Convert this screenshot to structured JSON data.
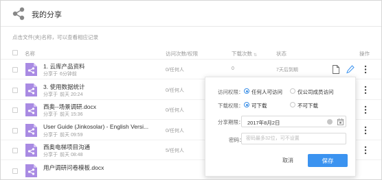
{
  "header": {
    "title": "我的分享"
  },
  "hint": "点击文件(夹)名称，可以查看相应记录",
  "columns": {
    "name": "名称",
    "access": "访问次数/权限",
    "downloads": "下载次数",
    "status": "状态",
    "actions": "操作"
  },
  "rows": [
    {
      "name": "1. 云库产品资料",
      "sub_prefix": "分享于",
      "sub_time": "6分钟前",
      "access": "0/任何人",
      "count": "0",
      "status": "7天后到期"
    },
    {
      "name": "3. 使用数据统计",
      "sub_prefix": "分享于",
      "sub_time": "前天 20:24",
      "access": "0/任何人",
      "count": "",
      "status": ""
    },
    {
      "name": "西奥--场景调研.docx",
      "sub_prefix": "分享于",
      "sub_time": "前天 15:36",
      "access": "0/任何人",
      "count": "",
      "status": ""
    },
    {
      "name": "User Guide (Jinkosolar) - English Versi...",
      "sub_prefix": "分享于",
      "sub_time": "前天 09:59",
      "access": "0/任何人",
      "count": "",
      "status": ""
    },
    {
      "name": "西奥电梯项目沟通",
      "sub_prefix": "分享于",
      "sub_time": "前天 08:48",
      "access": "5/任何人",
      "count": "",
      "status": ""
    },
    {
      "name": "用户调研问卷模板.docx",
      "sub_prefix": "",
      "sub_time": "",
      "access": "",
      "count": "",
      "status": ""
    }
  ],
  "popup": {
    "access_label": "访问权限：",
    "access_option_any": "任何人可访问",
    "access_option_company": "仅公司成员访问",
    "download_label": "下载权限：",
    "download_option_yes": "可下载",
    "download_option_no": "不可下载",
    "expiry_label": "分享期限：",
    "expiry_value": "2017年8月2日",
    "password_label": "密码：",
    "password_placeholder": "密码最多32位，可不设置",
    "cancel_label": "取消",
    "save_label": "保存"
  },
  "colors": {
    "accent": "#3b93f0",
    "file_icon": "#a98be3"
  },
  "icons": {
    "logo": "share-icon",
    "file": "share-file-icon",
    "row_actions": [
      "file-icon",
      "edit-icon",
      "more-icon"
    ]
  }
}
